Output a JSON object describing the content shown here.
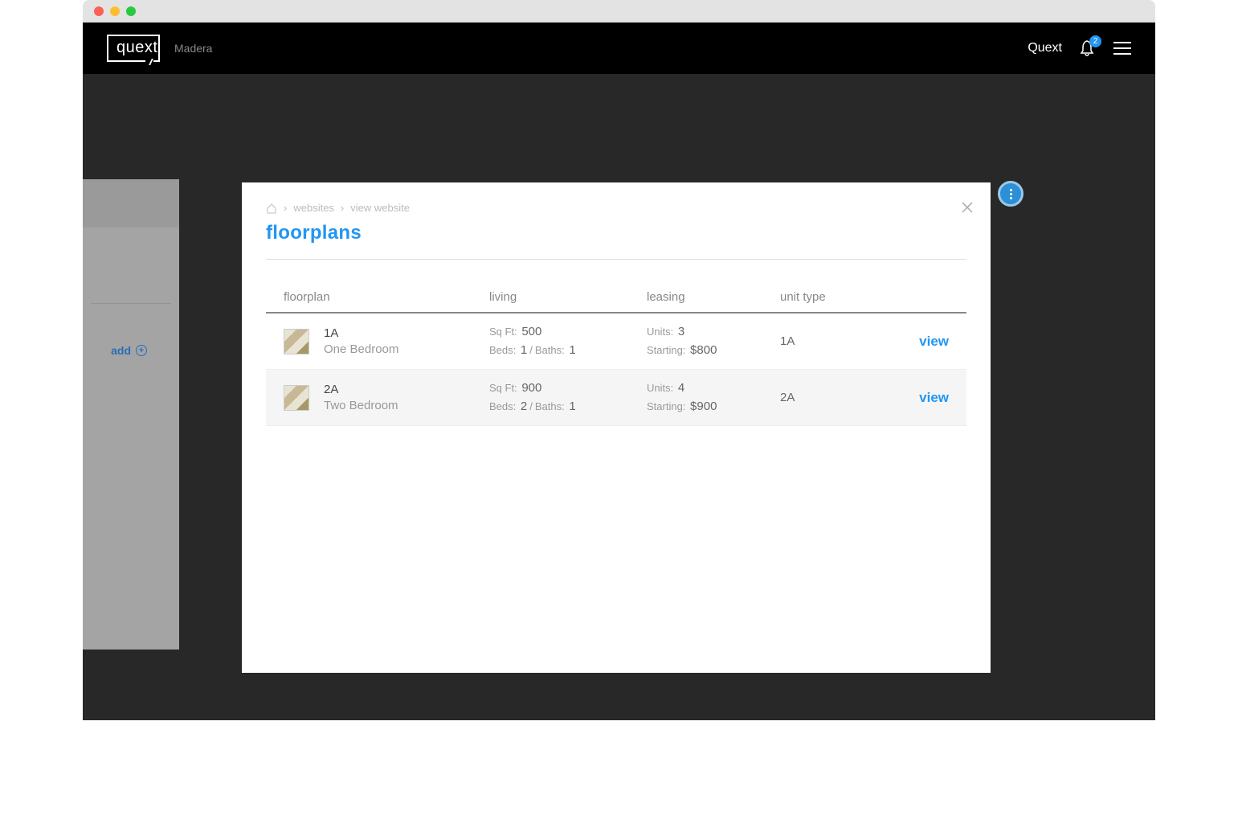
{
  "header": {
    "logo_text": "quext",
    "property_name": "Madera",
    "user_label": "Quext",
    "notification_count": "2"
  },
  "sidebar": {
    "add_label": "add"
  },
  "modal": {
    "breadcrumb": [
      "websites",
      "view website"
    ],
    "title": "floorplans",
    "table": {
      "headers": {
        "floorplan": "floorplan",
        "living": "living",
        "leasing": "leasing",
        "unit_type": "unit type"
      },
      "labels": {
        "sqft": "Sq Ft:",
        "beds": "Beds:",
        "baths": "Baths:",
        "units": "Units:",
        "starting": "Starting:",
        "view": "view"
      },
      "rows": [
        {
          "code": "1A",
          "name": "One Bedroom",
          "sqft": "500",
          "beds": "1",
          "baths": "1",
          "units": "3",
          "starting": "$800",
          "unit_type": "1A"
        },
        {
          "code": "2A",
          "name": "Two Bedroom",
          "sqft": "900",
          "beds": "2",
          "baths": "1",
          "units": "4",
          "starting": "$900",
          "unit_type": "2A"
        }
      ]
    }
  }
}
